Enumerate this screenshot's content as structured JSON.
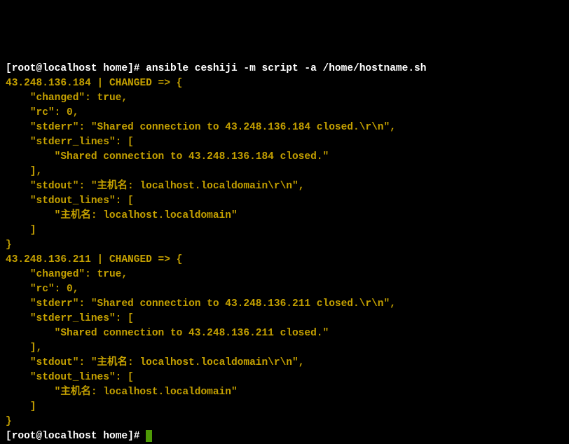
{
  "prompt": {
    "user": "root",
    "host": "localhost",
    "dir": "home",
    "symbol": "#"
  },
  "command": "ansible ceshiji -m script -a /home/hostname.sh",
  "hosts": [
    {
      "ip": "43.248.136.184",
      "status": "CHANGED",
      "changed": "true",
      "rc": "0",
      "stderr": "\"Shared connection to 43.248.136.184 closed.\\r\\n\"",
      "stderr_line": "\"Shared connection to 43.248.136.184 closed.\"",
      "stdout": "\"主机名: localhost.localdomain\\r\\n\"",
      "stdout_line": "\"主机名: localhost.localdomain\""
    },
    {
      "ip": "43.248.136.211",
      "status": "CHANGED",
      "changed": "true",
      "rc": "0",
      "stderr": "\"Shared connection to 43.248.136.211 closed.\\r\\n\"",
      "stderr_line": "\"Shared connection to 43.248.136.211 closed.\"",
      "stdout": "\"主机名: localhost.localdomain\\r\\n\"",
      "stdout_line": "\"主机名: localhost.localdomain\""
    }
  ],
  "labels": {
    "changed_key": "\"changed\"",
    "rc_key": "\"rc\"",
    "stderr_key": "\"stderr\"",
    "stderr_lines_key": "\"stderr_lines\"",
    "stdout_key": "\"stdout\"",
    "stdout_lines_key": "\"stdout_lines\""
  }
}
